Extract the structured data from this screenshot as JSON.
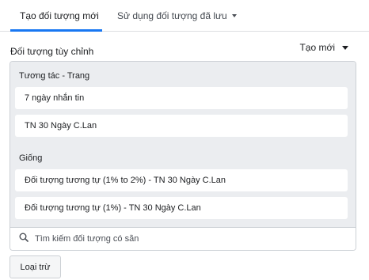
{
  "tabs": [
    {
      "label": "Tạo đối tượng mới",
      "active": true
    },
    {
      "label": "Sử dụng đối tượng đã lưu",
      "active": false
    }
  ],
  "section": {
    "title": "Đối tượng tùy chỉnh",
    "create_label": "Tạo mới"
  },
  "groups": [
    {
      "label": "Tương tác - Trang",
      "items": [
        "7 ngày nhắn tin",
        "TN 30 Ngày C.Lan"
      ]
    },
    {
      "label": "Giống",
      "items": [
        "Đối tượng tương tự (1% to 2%) - TN 30 Ngày C.Lan",
        "Đối tượng tương tự (1%) - TN 30 Ngày C.Lan"
      ]
    }
  ],
  "search": {
    "placeholder": "Tìm kiếm đối tượng có sẵn",
    "value": ""
  },
  "exclude_label": "Loại trừ",
  "colors": {
    "accent": "#1877f2",
    "box_background": "#ebedf0",
    "border": "#ccd0d5"
  },
  "icons": [
    "chevron-down-icon",
    "search-icon"
  ]
}
